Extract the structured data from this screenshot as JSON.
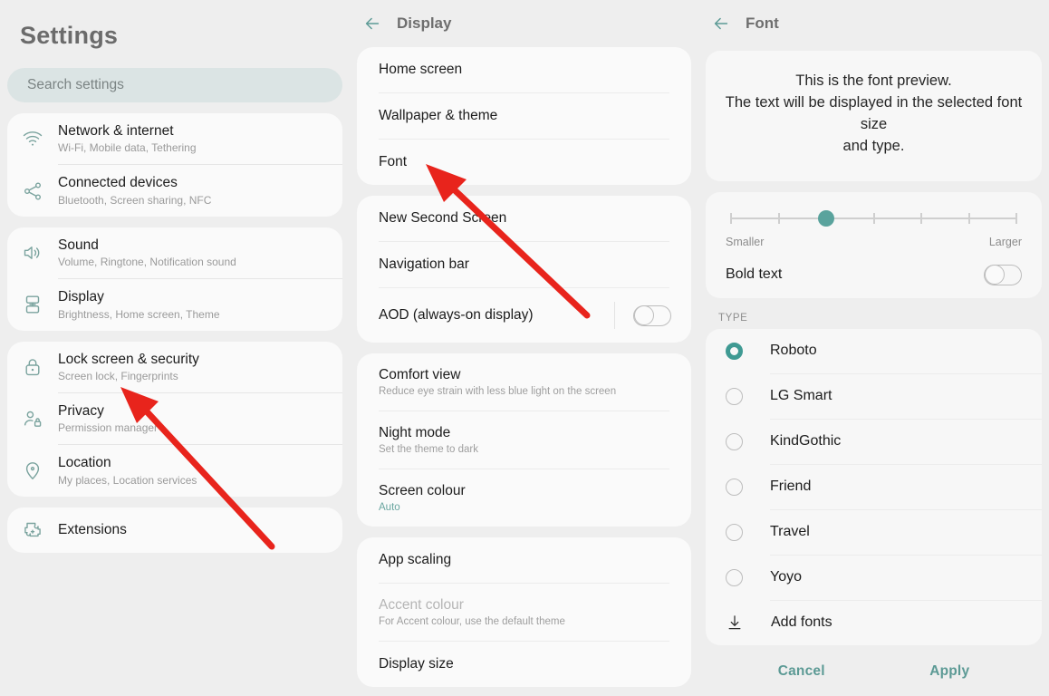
{
  "left": {
    "title": "Settings",
    "search": {
      "placeholder": "Search settings"
    },
    "groups": [
      {
        "items": [
          {
            "icon": "wifi-icon",
            "title": "Network & internet",
            "sub": "Wi-Fi, Mobile data, Tethering"
          },
          {
            "icon": "share-icon",
            "title": "Connected devices",
            "sub": "Bluetooth, Screen sharing, NFC"
          }
        ]
      },
      {
        "items": [
          {
            "icon": "speaker-icon",
            "title": "Sound",
            "sub": "Volume, Ringtone, Notification sound"
          },
          {
            "icon": "display-icon",
            "title": "Display",
            "sub": "Brightness, Home screen, Theme"
          }
        ]
      },
      {
        "items": [
          {
            "icon": "lock-icon",
            "title": "Lock screen & security",
            "sub": "Screen lock, Fingerprints"
          },
          {
            "icon": "privacy-person-icon",
            "title": "Privacy",
            "sub": "Permission manager"
          },
          {
            "icon": "location-pin-icon",
            "title": "Location",
            "sub": "My places, Location services"
          }
        ]
      },
      {
        "items": [
          {
            "icon": "extensions-icon",
            "title": "Extensions",
            "sub": ""
          }
        ]
      }
    ]
  },
  "mid": {
    "header": {
      "title": "Display",
      "back_icon": "back-arrow-icon"
    },
    "groups": [
      {
        "items": [
          {
            "title": "Home screen",
            "sub": "",
            "toggle": false,
            "disabled": false
          },
          {
            "title": "Wallpaper & theme",
            "sub": "",
            "toggle": false,
            "disabled": false
          },
          {
            "title": "Font",
            "sub": "",
            "toggle": false,
            "disabled": false
          }
        ]
      },
      {
        "items": [
          {
            "title": "New Second Screen",
            "sub": "",
            "toggle": false,
            "disabled": false
          },
          {
            "title": "Navigation bar",
            "sub": "",
            "toggle": false,
            "disabled": false
          },
          {
            "title": "AOD (always-on display)",
            "sub": "",
            "toggle": true,
            "toggle_on": false,
            "disabled": false
          }
        ]
      },
      {
        "items": [
          {
            "title": "Comfort view",
            "sub": "Reduce eye strain with less blue light on the screen",
            "toggle": false,
            "disabled": false
          },
          {
            "title": "Night mode",
            "sub": "Set the theme to dark",
            "toggle": false,
            "disabled": false
          },
          {
            "title": "Screen colour",
            "sub": "Auto",
            "sub_accent": true,
            "toggle": false,
            "disabled": false
          }
        ]
      },
      {
        "items": [
          {
            "title": "App scaling",
            "sub": "",
            "toggle": false,
            "disabled": false
          },
          {
            "title": "Accent colour",
            "sub": "For Accent colour, use the default theme",
            "toggle": false,
            "disabled": true
          },
          {
            "title": "Display size",
            "sub": "",
            "toggle": false,
            "disabled": false
          }
        ]
      }
    ]
  },
  "right": {
    "header": {
      "title": "Font",
      "back_icon": "back-arrow-icon"
    },
    "preview": {
      "line1": "This is the font preview.",
      "line2": "The text will be displayed in the selected font size",
      "line3": "and type."
    },
    "size_slider": {
      "label_min": "Smaller",
      "label_max": "Larger",
      "steps": 7,
      "value_index": 2
    },
    "bold_text": {
      "label": "Bold text",
      "on": false
    },
    "type_section_label": "TYPE",
    "fonts": [
      {
        "name": "Roboto",
        "selected": true
      },
      {
        "name": "LG Smart",
        "selected": false
      },
      {
        "name": "KindGothic",
        "selected": false
      },
      {
        "name": "Friend",
        "selected": false
      },
      {
        "name": "Travel",
        "selected": false
      },
      {
        "name": "Yoyo",
        "selected": false
      }
    ],
    "add_fonts": {
      "label": "Add fonts",
      "icon": "download-icon"
    },
    "actions": {
      "cancel": "Cancel",
      "apply": "Apply"
    }
  },
  "annotations": {
    "arrow_color": "#e8241c",
    "arrow1": "points-to-display-row",
    "arrow2": "points-to-font-row"
  }
}
